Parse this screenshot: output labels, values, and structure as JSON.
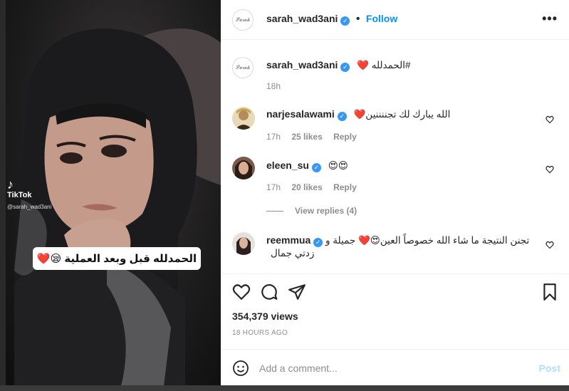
{
  "photo": {
    "caption_overlay": "الحمدلله قبل وبعد العملية 😪❤️",
    "tiktok_brand": "TikTok",
    "tiktok_user": "@sarah_wad3ani"
  },
  "header": {
    "username": "sarah_wad3ani",
    "separator": "•",
    "follow_label": "Follow",
    "more_label": "•••",
    "verified_icon": "verified-badge-icon"
  },
  "caption": {
    "username": "sarah_wad3ani",
    "text": "#الحمدلله ❤️",
    "time": "18h"
  },
  "comments": [
    {
      "username": "narjesalawami",
      "text": "الله يبارك لك تجننننين❤️",
      "time": "17h",
      "likes": "25 likes",
      "reply": "Reply"
    },
    {
      "username": "eleen_su",
      "text": "😍😍",
      "time": "17h",
      "likes": "20 likes",
      "reply": "Reply"
    },
    {
      "username": "reemmua",
      "text": "تجنن النتيجة ما شاء الله خصوصاً العين😍❤️ جميلة و زدتي جمال"
    }
  ],
  "view_replies": "View replies (4)",
  "actions": {
    "like_icon": "heart-icon",
    "comment_icon": "comment-icon",
    "share_icon": "share-icon",
    "save_icon": "bookmark-icon"
  },
  "views": "354,379 views",
  "posted_ago": "18 HOURS AGO",
  "add_comment": {
    "placeholder": "Add a comment...",
    "post_label": "Post",
    "emoji_icon": "emoji-icon"
  },
  "colors": {
    "accent": "#0095f6",
    "verified": "#3897f0",
    "post_disabled": "#b2dffc",
    "muted": "#8e8e8e"
  }
}
